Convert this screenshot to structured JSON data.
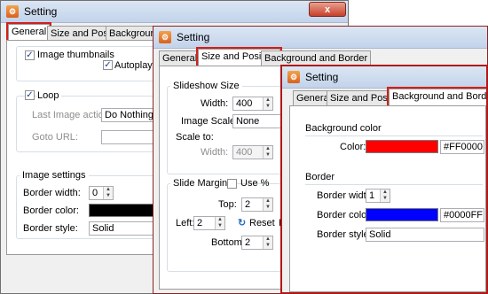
{
  "colors": {
    "highlight": "#d0201a",
    "black_swatch": "#000000",
    "red_swatch": "#ff0000",
    "blue_swatch": "#0000ff",
    "title_bar": "#c2d3ea"
  },
  "window1": {
    "title": "Setting",
    "close": "x",
    "tabs": [
      "General",
      "Size and Position",
      "Background a"
    ],
    "image_thumbnails": "Image thumbnails",
    "autoplay": "Autoplay",
    "loop": "Loop",
    "last_image_action_label": "Last Image action:",
    "last_image_action_value": "Do Nothing",
    "goto_url_label": "Goto URL:",
    "image_settings": "Image settings",
    "border_width_label": "Border width:",
    "border_width_value": "0",
    "border_color_label": "Border color:",
    "border_style_label": "Border style:",
    "border_style_value": "Solid"
  },
  "window2": {
    "title": "Setting",
    "tabs": [
      "General",
      "Size and Position",
      "Background and Border"
    ],
    "slideshow_size": "Slideshow Size",
    "width_label": "Width:",
    "width_value": "400",
    "image_scale_label": "Image Scale:",
    "image_scale_value": "None",
    "scale_to_label": "Scale to:",
    "scale_width_label": "Width:",
    "scale_width_value": "400",
    "slide_margins": "Slide Margins",
    "use_percent": "Use %",
    "top_label": "Top:",
    "top_value": "2",
    "left_label": "Left:",
    "left_value": "2",
    "reset": "Reset",
    "reset_cut": "R",
    "bottom_label": "Bottom:",
    "bottom_value": "2"
  },
  "window3": {
    "title": "Setting",
    "tabs": [
      "General",
      "Size and Position",
      "Background and Border"
    ],
    "background_color": "Background color",
    "color_label": "Color:",
    "color_value": "#FF0000",
    "border": "Border",
    "border_width_label": "Border width:",
    "border_width_value": "1",
    "border_color_label": "Border color:",
    "border_color_value": "#0000FF",
    "border_style_label": "Border style:",
    "border_style_value": "Solid"
  }
}
